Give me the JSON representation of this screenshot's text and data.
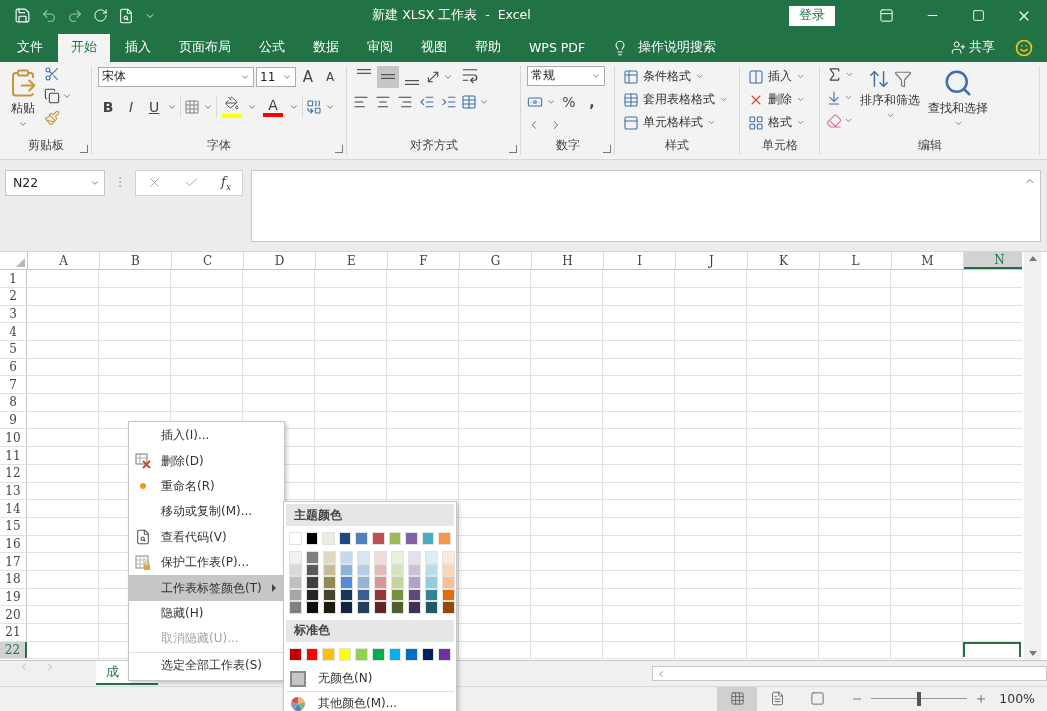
{
  "window": {
    "title": "新建 XLSX 工作表  -  Excel",
    "login": "登录"
  },
  "menu_tabs": [
    {
      "label": "文件",
      "selected": false
    },
    {
      "label": "开始",
      "selected": true
    },
    {
      "label": "插入",
      "selected": false
    },
    {
      "label": "页面布局",
      "selected": false
    },
    {
      "label": "公式",
      "selected": false
    },
    {
      "label": "数据",
      "selected": false
    },
    {
      "label": "审阅",
      "selected": false
    },
    {
      "label": "视图",
      "selected": false
    },
    {
      "label": "帮助",
      "selected": false
    },
    {
      "label": "WPS PDF",
      "selected": false
    }
  ],
  "tell_me": "操作说明搜索",
  "share": "共享",
  "clipboard": {
    "paste": "粘贴",
    "label": "剪贴板"
  },
  "font": {
    "name": "宋体",
    "size": "11",
    "grow": "A",
    "shrink": "A",
    "bold": "B",
    "italic": "I",
    "underline": "U",
    "font_color": "A",
    "label": "字体"
  },
  "alignment": {
    "vertical": [
      {
        "kind": "top",
        "selected": false
      },
      {
        "kind": "middle",
        "selected": true
      },
      {
        "kind": "bottom",
        "selected": false
      }
    ],
    "label": "对齐方式"
  },
  "number": {
    "format": "常规",
    "percent": "%",
    "comma": ",",
    "label": "数字"
  },
  "styles": {
    "items": [
      {
        "label": "条件格式",
        "kind": "conditional"
      },
      {
        "label": "套用表格格式",
        "kind": "table"
      },
      {
        "label": "单元格样式",
        "kind": "cell"
      }
    ],
    "label": "样式"
  },
  "cells": {
    "items": [
      {
        "label": "插入",
        "kind": "insert"
      },
      {
        "label": "删除",
        "kind": "delete"
      },
      {
        "label": "格式",
        "kind": "format"
      }
    ],
    "label": "单元格"
  },
  "editing": {
    "sort": "排序和筛选",
    "find": "查找和选择",
    "label": "编辑"
  },
  "formula_bar": {
    "name_box": "N22",
    "function": "f$_{x}$"
  },
  "sheet": {
    "columns": [
      {
        "label": "A",
        "selected": false
      },
      {
        "label": "B",
        "selected": false
      },
      {
        "label": "C",
        "selected": false
      },
      {
        "label": "D",
        "selected": false
      },
      {
        "label": "E",
        "selected": false
      },
      {
        "label": "F",
        "selected": false
      },
      {
        "label": "G",
        "selected": false
      },
      {
        "label": "H",
        "selected": false
      },
      {
        "label": "I",
        "selected": false
      },
      {
        "label": "J",
        "selected": false
      },
      {
        "label": "K",
        "selected": false
      },
      {
        "label": "L",
        "selected": false
      },
      {
        "label": "M",
        "selected": false
      },
      {
        "label": "N",
        "selected": true
      }
    ],
    "rows": [
      {
        "label": "1",
        "selected": false
      },
      {
        "label": "2",
        "selected": false
      },
      {
        "label": "3",
        "selected": false
      },
      {
        "label": "4",
        "selected": false
      },
      {
        "label": "5",
        "selected": false
      },
      {
        "label": "6",
        "selected": false
      },
      {
        "label": "7",
        "selected": false
      },
      {
        "label": "8",
        "selected": false
      },
      {
        "label": "9",
        "selected": false
      },
      {
        "label": "10",
        "selected": false
      },
      {
        "label": "11",
        "selected": false
      },
      {
        "label": "12",
        "selected": false
      },
      {
        "label": "13",
        "selected": false
      },
      {
        "label": "14",
        "selected": false
      },
      {
        "label": "15",
        "selected": false
      },
      {
        "label": "16",
        "selected": false
      },
      {
        "label": "17",
        "selected": false
      },
      {
        "label": "18",
        "selected": false
      },
      {
        "label": "19",
        "selected": false
      },
      {
        "label": "20",
        "selected": false
      },
      {
        "label": "21",
        "selected": false
      },
      {
        "label": "22",
        "selected": true
      }
    ]
  },
  "sheet_tabs": [
    {
      "label": "成",
      "selected": true
    }
  ],
  "context_menu": {
    "items": [
      {
        "label": "插入(I)...",
        "kind": "plain",
        "selected": false,
        "disabled": false,
        "separator_before": false
      },
      {
        "label": "删除(D)",
        "kind": "delete",
        "selected": false,
        "disabled": false,
        "separator_before": false
      },
      {
        "label": "重命名(R)",
        "kind": "dot",
        "selected": false,
        "disabled": false,
        "separator_before": false
      },
      {
        "label": "移动或复制(M)...",
        "kind": "plain",
        "selected": false,
        "disabled": false,
        "separator_before": false
      },
      {
        "label": "查看代码(V)",
        "kind": "code",
        "selected": false,
        "disabled": false,
        "separator_before": false
      },
      {
        "label": "保护工作表(P)...",
        "kind": "protect",
        "selected": false,
        "disabled": false,
        "separator_before": false
      },
      {
        "label": "工作表标签颜色(T)",
        "kind": "submenu",
        "selected": true,
        "disabled": false,
        "separator_before": false
      },
      {
        "label": "隐藏(H)",
        "kind": "plain",
        "selected": false,
        "disabled": false,
        "separator_before": false
      },
      {
        "label": "取消隐藏(U)...",
        "kind": "plain",
        "selected": false,
        "disabled": true,
        "separator_before": false
      },
      {
        "label": "选定全部工作表(S)",
        "kind": "plain",
        "selected": false,
        "disabled": false,
        "separator_before": true
      }
    ]
  },
  "color_menu": {
    "theme_title": "主题颜色",
    "theme_colors": [
      {
        "color": "#ffffff",
        "shades": [
          {
            "color": "#f2f2f2"
          },
          {
            "color": "#d9d9d9"
          },
          {
            "color": "#bfbfbf"
          },
          {
            "color": "#a6a6a6"
          },
          {
            "color": "#808080"
          }
        ]
      },
      {
        "color": "#000000",
        "shades": [
          {
            "color": "#7f7f7f"
          },
          {
            "color": "#595959"
          },
          {
            "color": "#3f3f3f"
          },
          {
            "color": "#262626"
          },
          {
            "color": "#0d0d0d"
          }
        ]
      },
      {
        "color": "#eeece1",
        "shades": [
          {
            "color": "#ddd9c3"
          },
          {
            "color": "#c4bd97"
          },
          {
            "color": "#938953"
          },
          {
            "color": "#494429"
          },
          {
            "color": "#1d1b10"
          }
        ]
      },
      {
        "color": "#1f497d",
        "shades": [
          {
            "color": "#c6d9f0"
          },
          {
            "color": "#8db3e2"
          },
          {
            "color": "#548dd4"
          },
          {
            "color": "#17365d"
          },
          {
            "color": "#0f243e"
          }
        ]
      },
      {
        "color": "#4f81bd",
        "shades": [
          {
            "color": "#dbe5f1"
          },
          {
            "color": "#b8cce4"
          },
          {
            "color": "#95b3d7"
          },
          {
            "color": "#366092"
          },
          {
            "color": "#244061"
          }
        ]
      },
      {
        "color": "#c0504d",
        "shades": [
          {
            "color": "#f2dcdb"
          },
          {
            "color": "#e5b9b7"
          },
          {
            "color": "#d99694"
          },
          {
            "color": "#953734"
          },
          {
            "color": "#632423"
          }
        ]
      },
      {
        "color": "#9bbb59",
        "shades": [
          {
            "color": "#ebf1dd"
          },
          {
            "color": "#d7e3bc"
          },
          {
            "color": "#c3d69b"
          },
          {
            "color": "#76923c"
          },
          {
            "color": "#4f6128"
          }
        ]
      },
      {
        "color": "#8064a2",
        "shades": [
          {
            "color": "#e5e0ec"
          },
          {
            "color": "#ccc1d9"
          },
          {
            "color": "#b2a2c7"
          },
          {
            "color": "#5f497a"
          },
          {
            "color": "#3f3151"
          }
        ]
      },
      {
        "color": "#4bacc6",
        "shades": [
          {
            "color": "#dbeef3"
          },
          {
            "color": "#b7dde8"
          },
          {
            "color": "#92cddc"
          },
          {
            "color": "#31859b"
          },
          {
            "color": "#205867"
          }
        ]
      },
      {
        "color": "#f79646",
        "shades": [
          {
            "color": "#fdeada"
          },
          {
            "color": "#fbd5b5"
          },
          {
            "color": "#fac08f"
          },
          {
            "color": "#e36c09"
          },
          {
            "color": "#974806"
          }
        ]
      }
    ],
    "standard_title": "标准色",
    "standard_colors": [
      {
        "color": "#c00000"
      },
      {
        "color": "#ff0000"
      },
      {
        "color": "#ffc000"
      },
      {
        "color": "#ffff00"
      },
      {
        "color": "#92d050"
      },
      {
        "color": "#00b050"
      },
      {
        "color": "#00b0f0"
      },
      {
        "color": "#0070c0"
      },
      {
        "color": "#002060"
      },
      {
        "color": "#7030a0"
      }
    ],
    "no_color": "无颜色(N)",
    "more_colors": "其他颜色(M)..."
  },
  "status_bar": {
    "views": [
      {
        "kind": "normal",
        "selected": true
      },
      {
        "kind": "page_layout",
        "selected": false
      },
      {
        "kind": "page_break",
        "selected": false
      }
    ],
    "zoom": {
      "level": 0.5,
      "reading": "100%"
    }
  }
}
